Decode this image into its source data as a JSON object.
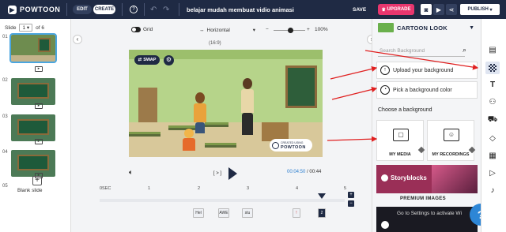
{
  "topbar": {
    "logo": "POWTOON",
    "edit_label": "EDIT",
    "create_label": "CREATE",
    "help_icon": "?",
    "title": "belajar mudah membuat vidio animasi",
    "save_label": "SAVE",
    "upgrade_label": "UPGRADE",
    "publish_label": "PUBLISH"
  },
  "slides": {
    "slide_label": "Slide",
    "current": "1",
    "of_label": "of 6",
    "numbers": [
      "01",
      "02",
      "03",
      "04",
      "05"
    ],
    "blank_slide_label": "Blank slide"
  },
  "canvas": {
    "grid_label": "Grid",
    "orientation_label": "Horizontal",
    "zoom_label": "100%",
    "ratio_label": "(16:9)",
    "swap_label": "SWAP",
    "watermark_small": "CREATED USING",
    "watermark_brand": "POWTOON",
    "play_pair": "[ > ]",
    "time_current": "00:04:50",
    "time_total": "/ 00:44"
  },
  "timeline": {
    "ticks": [
      "0SEC",
      "1",
      "2",
      "3",
      "4",
      "5"
    ],
    "chips": [
      "Hel",
      "AWE",
      "stu",
      "!",
      "2"
    ],
    "zoom_in": "+",
    "zoom_out": "−"
  },
  "right_panel": {
    "category": "CARTOON LOOK",
    "search_placeholder": "Search Background",
    "upload_label": "Upload your background",
    "color_label": "Pick a background color",
    "choose_label": "Choose a background",
    "my_media_label": "MY MEDIA",
    "my_recordings_label": "MY RECORDINGS",
    "storyblocks_label": "Storyblocks",
    "premium_label": "PREMIUM IMAGES",
    "overlay_text": "Go to Settings to activate Wi",
    "help_button": "?"
  },
  "icons": {
    "rail": [
      "layout-icon",
      "background-icon",
      "text-icon",
      "characters-icon",
      "props-icon",
      "shapes-icon",
      "media-icon",
      "video-icon",
      "music-icon"
    ]
  },
  "colors": {
    "navy": "#1f2a44",
    "upgrade": "#e8366e",
    "accent_blue": "#2d86d6",
    "annotation_red": "#e02020"
  }
}
